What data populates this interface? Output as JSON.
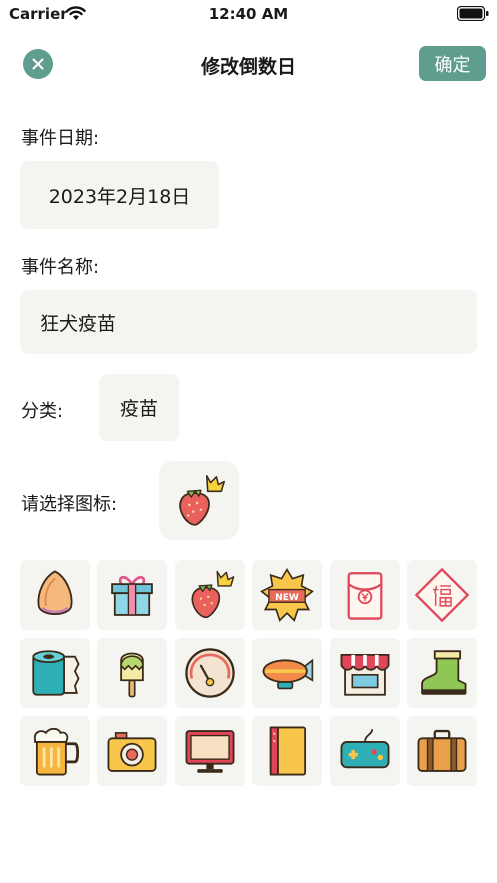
{
  "status_bar": {
    "carrier": "Carrier",
    "time": "12:40 AM"
  },
  "nav": {
    "title": "修改倒数日",
    "confirm_label": "确定",
    "close_icon": "close-icon"
  },
  "form": {
    "date_label": "事件日期:",
    "date_value": "2023年2月18日",
    "name_label": "事件名称:",
    "name_value": "狂犬疫苗",
    "category_label": "分类:",
    "category_value": "疫苗",
    "icon_label": "请选择图标:",
    "selected_icon": "strawberry-crown-icon"
  },
  "icons": [
    "almond-icon",
    "gift-box-icon",
    "strawberry-crown-icon",
    "new-badge-icon",
    "red-envelope-icon",
    "fu-card-icon",
    "toilet-paper-icon",
    "popsicle-icon",
    "gauge-icon",
    "airship-icon",
    "shop-icon",
    "boot-icon",
    "beer-mug-icon",
    "camera-icon",
    "monitor-icon",
    "book-icon",
    "gamepad-icon",
    "suitcase-icon"
  ],
  "colors": {
    "accent": "#5f9d8e",
    "field_bg": "#f4f4f0"
  }
}
